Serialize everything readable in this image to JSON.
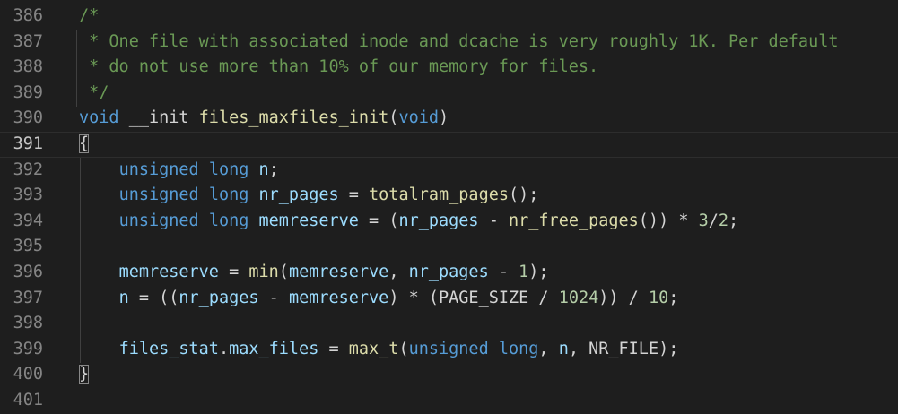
{
  "editor": {
    "lines": [
      {
        "num": "386",
        "tokens": [
          {
            "t": "/*",
            "c": "comment"
          }
        ]
      },
      {
        "num": "387",
        "tokens": [
          {
            "t": " * One file with associated inode and dcache is very roughly 1K. Per default",
            "c": "comment"
          }
        ]
      },
      {
        "num": "388",
        "tokens": [
          {
            "t": " * do not use more than 10% of our memory for files.",
            "c": "comment"
          }
        ]
      },
      {
        "num": "389",
        "tokens": [
          {
            "t": " */",
            "c": "comment"
          }
        ]
      },
      {
        "num": "390",
        "tokens": [
          {
            "t": "void",
            "c": "keyword"
          },
          {
            "t": " __init ",
            "c": "plain"
          },
          {
            "t": "files_maxfiles_init",
            "c": "fn"
          },
          {
            "t": "(",
            "c": "plain"
          },
          {
            "t": "void",
            "c": "keyword"
          },
          {
            "t": ")",
            "c": "plain"
          }
        ]
      },
      {
        "num": "391",
        "current": true,
        "tokens": [
          {
            "t": "{",
            "c": "brace"
          }
        ]
      },
      {
        "num": "392",
        "tokens": [
          {
            "t": "    ",
            "c": "plain"
          },
          {
            "t": "unsigned",
            "c": "keyword"
          },
          {
            "t": " ",
            "c": "plain"
          },
          {
            "t": "long",
            "c": "keyword"
          },
          {
            "t": " ",
            "c": "plain"
          },
          {
            "t": "n",
            "c": "var"
          },
          {
            "t": ";",
            "c": "plain"
          }
        ]
      },
      {
        "num": "393",
        "tokens": [
          {
            "t": "    ",
            "c": "plain"
          },
          {
            "t": "unsigned",
            "c": "keyword"
          },
          {
            "t": " ",
            "c": "plain"
          },
          {
            "t": "long",
            "c": "keyword"
          },
          {
            "t": " ",
            "c": "plain"
          },
          {
            "t": "nr_pages",
            "c": "var"
          },
          {
            "t": " = ",
            "c": "plain"
          },
          {
            "t": "totalram_pages",
            "c": "fn"
          },
          {
            "t": "();",
            "c": "plain"
          }
        ]
      },
      {
        "num": "394",
        "tokens": [
          {
            "t": "    ",
            "c": "plain"
          },
          {
            "t": "unsigned",
            "c": "keyword"
          },
          {
            "t": " ",
            "c": "plain"
          },
          {
            "t": "long",
            "c": "keyword"
          },
          {
            "t": " ",
            "c": "plain"
          },
          {
            "t": "memreserve",
            "c": "var"
          },
          {
            "t": " = (",
            "c": "plain"
          },
          {
            "t": "nr_pages",
            "c": "var"
          },
          {
            "t": " - ",
            "c": "plain"
          },
          {
            "t": "nr_free_pages",
            "c": "fn"
          },
          {
            "t": "()) * ",
            "c": "plain"
          },
          {
            "t": "3",
            "c": "num"
          },
          {
            "t": "/",
            "c": "plain"
          },
          {
            "t": "2",
            "c": "num"
          },
          {
            "t": ";",
            "c": "plain"
          }
        ]
      },
      {
        "num": "395",
        "tokens": []
      },
      {
        "num": "396",
        "tokens": [
          {
            "t": "    ",
            "c": "plain"
          },
          {
            "t": "memreserve",
            "c": "var"
          },
          {
            "t": " = ",
            "c": "plain"
          },
          {
            "t": "min",
            "c": "fn"
          },
          {
            "t": "(",
            "c": "plain"
          },
          {
            "t": "memreserve",
            "c": "var"
          },
          {
            "t": ", ",
            "c": "plain"
          },
          {
            "t": "nr_pages",
            "c": "var"
          },
          {
            "t": " - ",
            "c": "plain"
          },
          {
            "t": "1",
            "c": "num"
          },
          {
            "t": ");",
            "c": "plain"
          }
        ]
      },
      {
        "num": "397",
        "tokens": [
          {
            "t": "    ",
            "c": "plain"
          },
          {
            "t": "n",
            "c": "var"
          },
          {
            "t": " = ((",
            "c": "plain"
          },
          {
            "t": "nr_pages",
            "c": "var"
          },
          {
            "t": " - ",
            "c": "plain"
          },
          {
            "t": "memreserve",
            "c": "var"
          },
          {
            "t": ") * (PAGE_SIZE / ",
            "c": "plain"
          },
          {
            "t": "1024",
            "c": "num"
          },
          {
            "t": ")) / ",
            "c": "plain"
          },
          {
            "t": "10",
            "c": "num"
          },
          {
            "t": ";",
            "c": "plain"
          }
        ]
      },
      {
        "num": "398",
        "tokens": []
      },
      {
        "num": "399",
        "tokens": [
          {
            "t": "    ",
            "c": "plain"
          },
          {
            "t": "files_stat",
            "c": "var"
          },
          {
            "t": ".",
            "c": "plain"
          },
          {
            "t": "max_files",
            "c": "var"
          },
          {
            "t": " = ",
            "c": "plain"
          },
          {
            "t": "max_t",
            "c": "fn"
          },
          {
            "t": "(",
            "c": "plain"
          },
          {
            "t": "unsigned",
            "c": "keyword"
          },
          {
            "t": " ",
            "c": "plain"
          },
          {
            "t": "long",
            "c": "keyword"
          },
          {
            "t": ", ",
            "c": "plain"
          },
          {
            "t": "n",
            "c": "var"
          },
          {
            "t": ", NR_FILE);",
            "c": "plain"
          }
        ]
      },
      {
        "num": "400",
        "tokens": [
          {
            "t": "}",
            "c": "brace"
          }
        ]
      },
      {
        "num": "401",
        "tokens": []
      }
    ]
  }
}
